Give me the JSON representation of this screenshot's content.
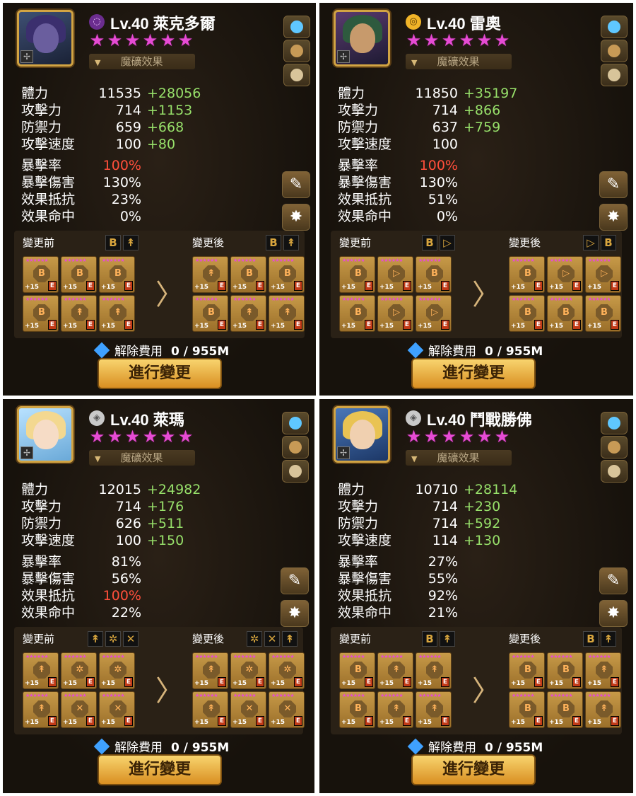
{
  "ui": {
    "rune_effect_label": "魔礦效果",
    "before_label": "變更前",
    "after_label": "變更後",
    "cost_label": "解除費用",
    "cost_value": "0 / 955M",
    "action_button": "進行變更",
    "stat_labels": [
      "體力",
      "攻擊力",
      "防禦力",
      "攻擊速度",
      "暴擊率",
      "暴擊傷害",
      "效果抵抗",
      "效果命中"
    ]
  },
  "panels": [
    {
      "name": "Lv.40 萊克多爾",
      "stars": 6,
      "attribute": "dark",
      "stats": [
        {
          "base": "11535",
          "bonus": "+28056"
        },
        {
          "base": "714",
          "bonus": "+1153"
        },
        {
          "base": "659",
          "bonus": "+668"
        },
        {
          "base": "100",
          "bonus": "+80"
        },
        {
          "base": "100%",
          "bonus": "",
          "highlight": true
        },
        {
          "base": "130%",
          "bonus": ""
        },
        {
          "base": "23%",
          "bonus": ""
        },
        {
          "base": "0%",
          "bonus": ""
        }
      ],
      "sets_before": [
        "B",
        "↟"
      ],
      "sets_after": [
        "B",
        "↟"
      ],
      "runes_before": [
        "B",
        "B",
        "B",
        "B",
        "↟",
        "↟"
      ],
      "runes_after": [
        "↟",
        "B",
        "B",
        "B",
        "↟",
        "↟"
      ]
    },
    {
      "name": "Lv.40 雷奧",
      "stars": 6,
      "attribute": "light",
      "stats": [
        {
          "base": "11850",
          "bonus": "+35197"
        },
        {
          "base": "714",
          "bonus": "+866"
        },
        {
          "base": "637",
          "bonus": "+759"
        },
        {
          "base": "100",
          "bonus": ""
        },
        {
          "base": "100%",
          "bonus": "",
          "highlight": true
        },
        {
          "base": "130%",
          "bonus": ""
        },
        {
          "base": "51%",
          "bonus": ""
        },
        {
          "base": "0%",
          "bonus": ""
        }
      ],
      "sets_before": [
        "B",
        "▷"
      ],
      "sets_after": [
        "▷",
        "B"
      ],
      "runes_before": [
        "B",
        "▷",
        "B",
        "B",
        "▷",
        "▷"
      ],
      "runes_after": [
        "B",
        "▷",
        "▷",
        "B",
        "B",
        "B"
      ]
    },
    {
      "name": "Lv.40 萊瑪",
      "stars": 6,
      "attribute": "neutral",
      "stats": [
        {
          "base": "12015",
          "bonus": "+24982"
        },
        {
          "base": "714",
          "bonus": "+176"
        },
        {
          "base": "626",
          "bonus": "+511"
        },
        {
          "base": "100",
          "bonus": "+150"
        },
        {
          "base": "81%",
          "bonus": ""
        },
        {
          "base": "56%",
          "bonus": ""
        },
        {
          "base": "100%",
          "bonus": "",
          "highlight": true
        },
        {
          "base": "22%",
          "bonus": ""
        }
      ],
      "sets_before": [
        "↟",
        "✲",
        "✕"
      ],
      "sets_after": [
        "✲",
        "✕",
        "↟"
      ],
      "runes_before": [
        "↟",
        "✲",
        "✲",
        "↟",
        "✕",
        "✕"
      ],
      "runes_after": [
        "↟",
        "✲",
        "✲",
        "↟",
        "✕",
        "✕"
      ]
    },
    {
      "name": "Lv.40 鬥戰勝佛",
      "stars": 6,
      "attribute": "neutral",
      "stats": [
        {
          "base": "10710",
          "bonus": "+28114"
        },
        {
          "base": "714",
          "bonus": "+230"
        },
        {
          "base": "714",
          "bonus": "+592"
        },
        {
          "base": "114",
          "bonus": "+130"
        },
        {
          "base": "27%",
          "bonus": ""
        },
        {
          "base": "55%",
          "bonus": ""
        },
        {
          "base": "92%",
          "bonus": ""
        },
        {
          "base": "21%",
          "bonus": ""
        }
      ],
      "sets_before": [
        "B",
        "↟"
      ],
      "sets_after": [
        "B",
        "↟"
      ],
      "runes_before": [
        "B",
        "↟",
        "↟",
        "B",
        "↟",
        "↟"
      ],
      "runes_after": [
        "B",
        "B",
        "↟",
        "B",
        "B",
        "↟"
      ]
    }
  ]
}
